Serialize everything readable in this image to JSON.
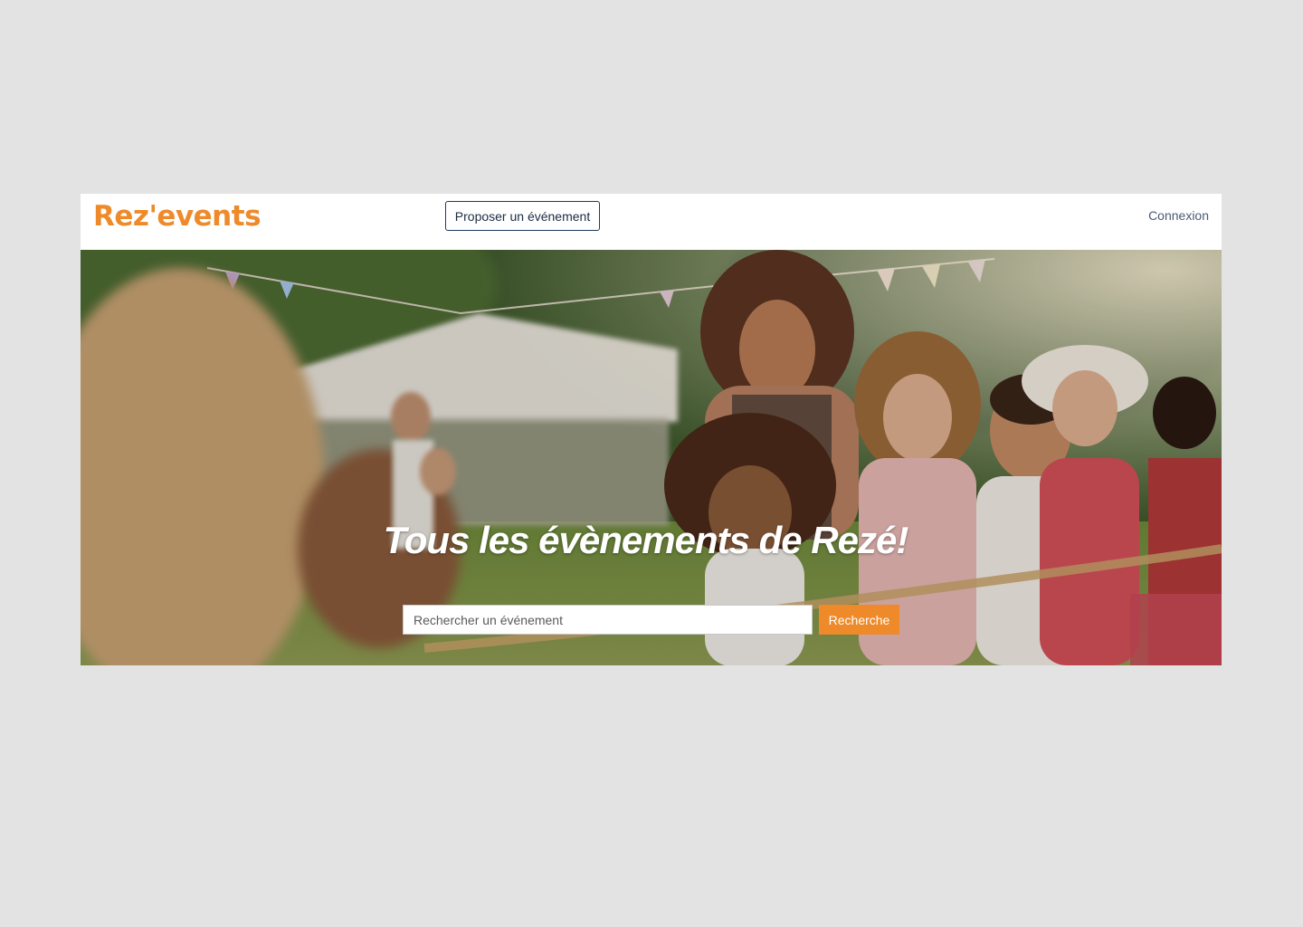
{
  "header": {
    "logo_text": "Rez'events",
    "propose_label": "Proposer un événement",
    "login_label": "Connexion"
  },
  "hero": {
    "title": "Tous les évènements de Rezé!",
    "search_placeholder": "Rechercher un événement",
    "search_button_label": "Recherche"
  },
  "colors": {
    "brand_orange": "#ee8a2a",
    "navy": "#1f3a5a",
    "page_background": "#e3e3e3"
  }
}
